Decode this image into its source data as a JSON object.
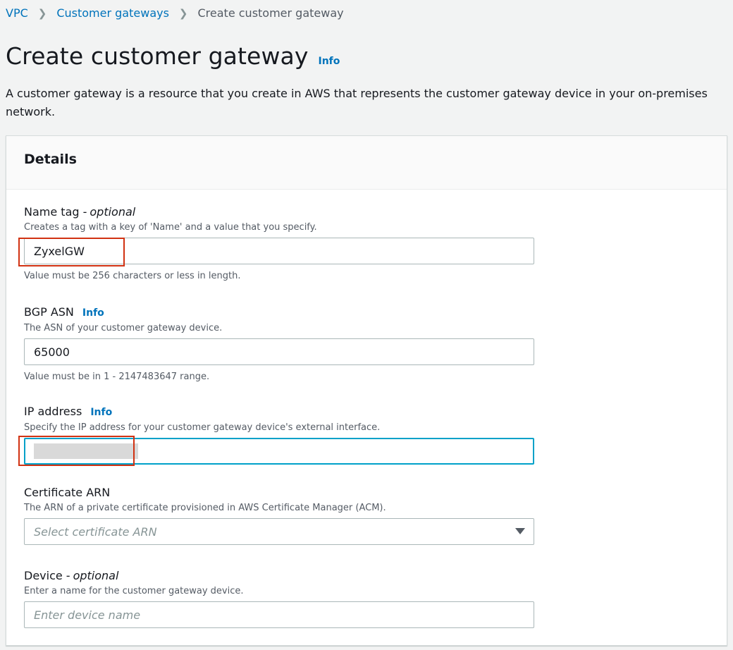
{
  "breadcrumb": {
    "items": [
      "VPC",
      "Customer gateways"
    ],
    "current": "Create customer gateway"
  },
  "header": {
    "title": "Create customer gateway",
    "info": "Info",
    "description": "A customer gateway is a resource that you create in AWS that represents the customer gateway device in your on-premises network."
  },
  "panel": {
    "title": "Details"
  },
  "fields": {
    "name_tag": {
      "label": "Name tag -",
      "optional": "optional",
      "description": "Creates a tag with a key of 'Name' and a value that you specify.",
      "value": "ZyxelGW",
      "constraint": "Value must be 256 characters or less in length."
    },
    "bgp_asn": {
      "label": "BGP ASN",
      "info": "Info",
      "description": "The ASN of your customer gateway device.",
      "value": "65000",
      "constraint": "Value must be in 1 - 2147483647 range."
    },
    "ip_address": {
      "label": "IP address",
      "info": "Info",
      "description": "Specify the IP address for your customer gateway device's external interface.",
      "value": ""
    },
    "certificate_arn": {
      "label": "Certificate ARN",
      "description": "The ARN of a private certificate provisioned in AWS Certificate Manager (ACM).",
      "placeholder": "Select certificate ARN"
    },
    "device": {
      "label": "Device -",
      "optional": "optional",
      "description": "Enter a name for the customer gateway device.",
      "placeholder": "Enter device name"
    }
  },
  "colors": {
    "link": "#0073bb",
    "focus": "#00a1c9",
    "highlight": "#d13212"
  }
}
